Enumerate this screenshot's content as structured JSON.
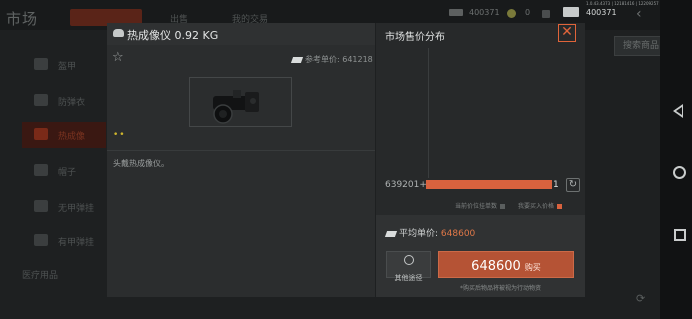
{
  "background": {
    "title": "市场",
    "tabs": [
      "出售",
      "我的交易"
    ],
    "resources": {
      "money": "400371",
      "coins": "0",
      "wallet": "400371",
      "status_line": "1.0.43.4373 | 12181416 | 12209257 |"
    },
    "search_button": "搜索商品",
    "sidebar": [
      "盔甲",
      "防弹衣",
      "热成像",
      "帽子",
      "无甲弹挂",
      "有甲弹挂"
    ],
    "sub_section": "医疗用品"
  },
  "item": {
    "name": "热成像仪 0.92 KG",
    "reference_price": "参考单价: 641218",
    "rarity_dots": "••",
    "description": "头戴热成像仪。"
  },
  "distribution": {
    "title": "市场售价分布",
    "rows": [
      {
        "price": "639201+",
        "count": "1",
        "fraction": 1.0
      }
    ],
    "legend": [
      "当前价位挂单数",
      "我要买入价格"
    ],
    "colors": {
      "bar": "#d9623e",
      "legend_current": "#5a5e5e",
      "legend_mine": "#d9623e"
    }
  },
  "purchase": {
    "avg_label": "平均单价:",
    "avg_value": "648600",
    "other_label": "其他途径",
    "buy_price": "648600",
    "buy_label": "购买",
    "note": "*购买后物品将被视为行动物资"
  },
  "icons": [
    "star-icon",
    "money-icon",
    "close-icon",
    "refresh-icon",
    "search-icon",
    "thermal-device-icon"
  ]
}
